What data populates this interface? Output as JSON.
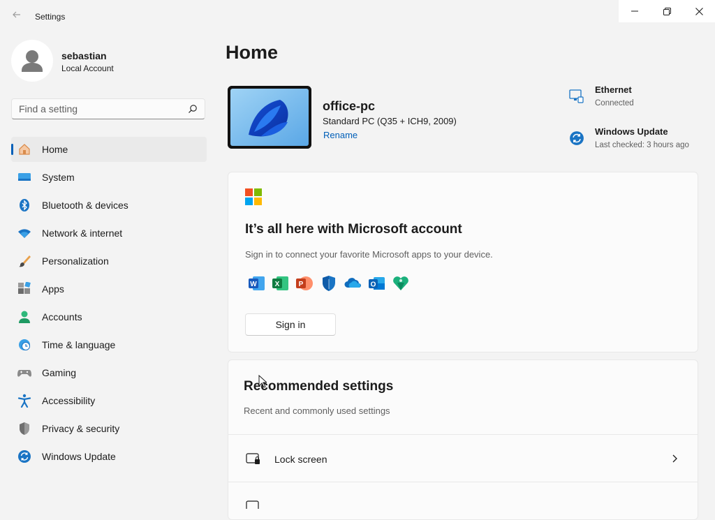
{
  "window": {
    "title": "Settings",
    "back_icon": "arrow-left-icon",
    "controls": [
      "minimize-icon",
      "restore-icon",
      "close-icon"
    ]
  },
  "profile": {
    "name": "sebastian",
    "account_type": "Local Account",
    "avatar_icon": "person-icon"
  },
  "search": {
    "placeholder": "Find a setting",
    "value": "",
    "icon": "search-icon"
  },
  "sidebar": {
    "accent_color": "#005fb8",
    "items": [
      {
        "label": "Home",
        "icon": "home-icon",
        "active": true
      },
      {
        "label": "System",
        "icon": "system-icon",
        "active": false
      },
      {
        "label": "Bluetooth & devices",
        "icon": "bluetooth-icon",
        "active": false
      },
      {
        "label": "Network & internet",
        "icon": "wifi-icon",
        "active": false
      },
      {
        "label": "Personalization",
        "icon": "brush-icon",
        "active": false
      },
      {
        "label": "Apps",
        "icon": "apps-icon",
        "active": false
      },
      {
        "label": "Accounts",
        "icon": "accounts-icon",
        "active": false
      },
      {
        "label": "Time & language",
        "icon": "clock-globe-icon",
        "active": false
      },
      {
        "label": "Gaming",
        "icon": "gamepad-icon",
        "active": false
      },
      {
        "label": "Accessibility",
        "icon": "accessibility-icon",
        "active": false
      },
      {
        "label": "Privacy & security",
        "icon": "shield-icon",
        "active": false
      },
      {
        "label": "Windows Update",
        "icon": "update-icon",
        "active": false
      }
    ]
  },
  "main": {
    "title": "Home",
    "device": {
      "name": "office-pc",
      "description": "Standard PC (Q35 + ICH9, 2009)",
      "rename_label": "Rename",
      "thumbnail_icon": "windows-bloom-wallpaper"
    },
    "status": [
      {
        "title": "Ethernet",
        "subtitle": "Connected",
        "icon": "ethernet-icon"
      },
      {
        "title": "Windows Update",
        "subtitle": "Last checked: 3 hours ago",
        "icon": "update-icon"
      }
    ],
    "ms_account": {
      "logo": "microsoft-logo-icon",
      "title": "It’s all here with Microsoft account",
      "subtitle": "Sign in to connect your favorite Microsoft apps to your device.",
      "apps": [
        "word-icon",
        "excel-icon",
        "powerpoint-icon",
        "defender-icon",
        "onedrive-icon",
        "outlook-icon",
        "family-icon"
      ],
      "sign_in_label": "Sign in"
    },
    "recommended": {
      "title": "Recommended settings",
      "subtitle": "Recent and commonly used settings",
      "items": [
        {
          "label": "Lock screen",
          "icon": "lock-screen-icon"
        }
      ]
    }
  }
}
